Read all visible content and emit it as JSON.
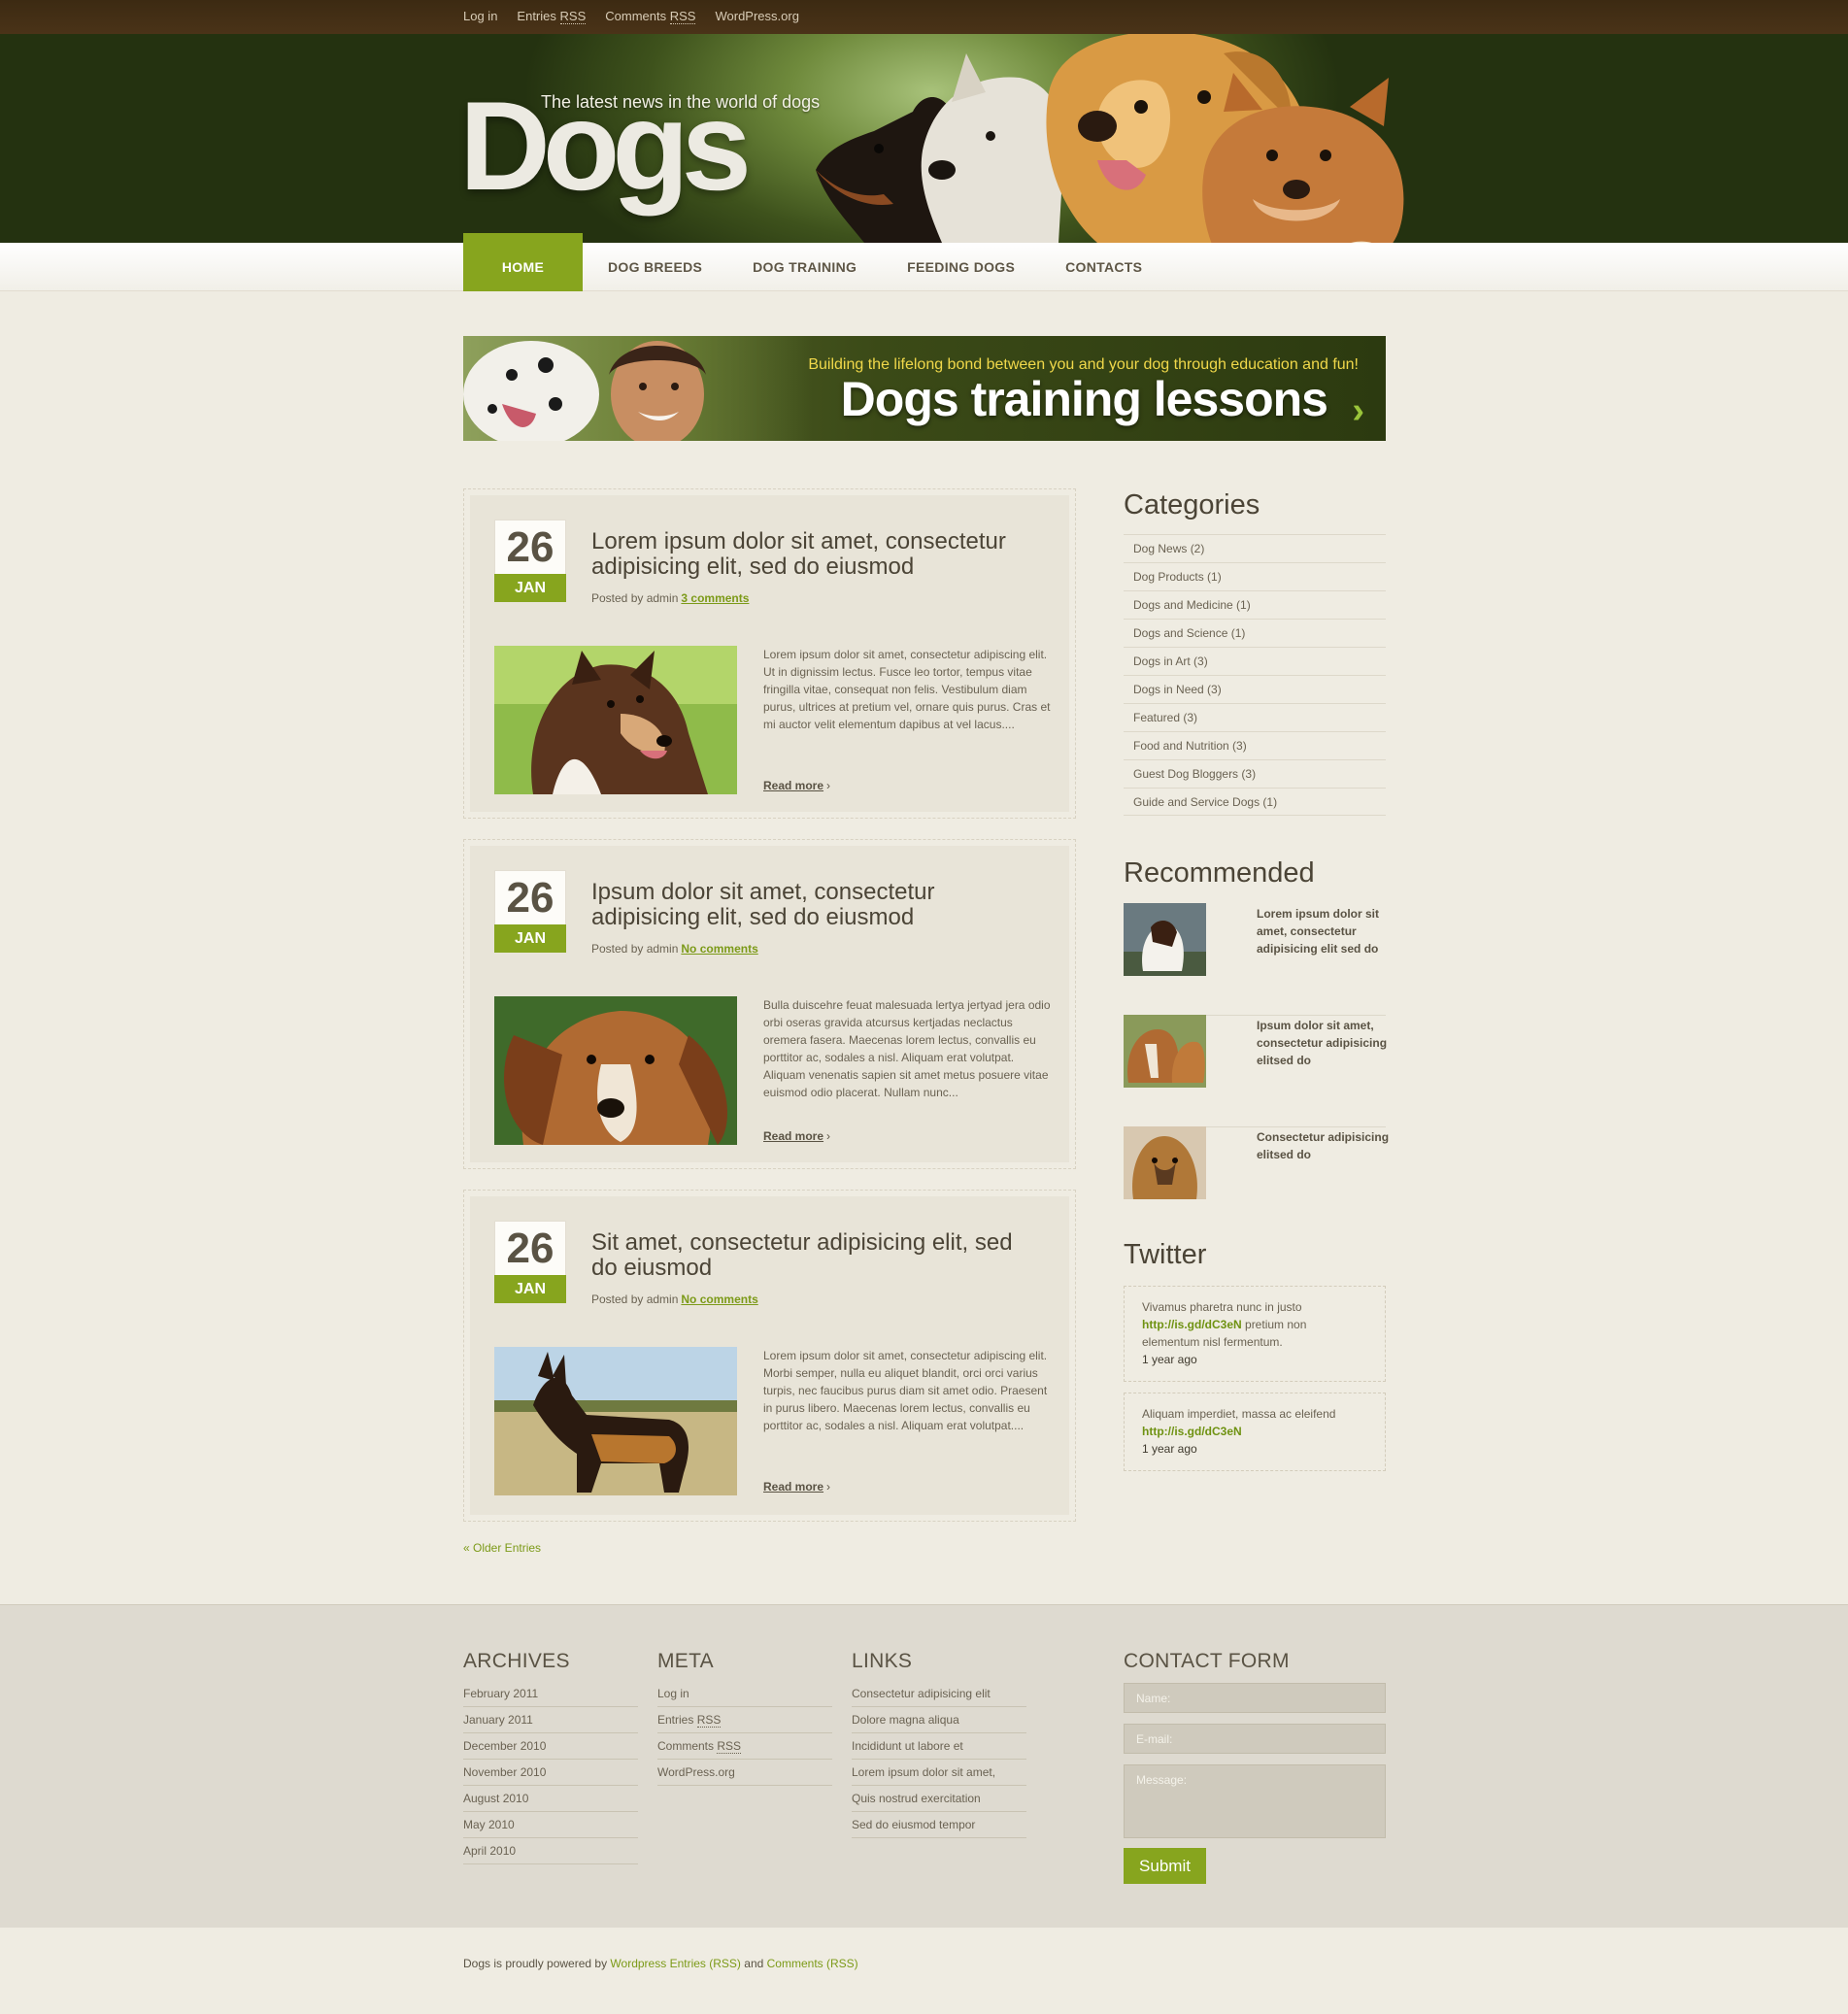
{
  "topbar": {
    "login": "Log in",
    "entries": "Entries",
    "comments": "Comments",
    "rss": "RSS",
    "wordpress": "WordPress.org"
  },
  "header": {
    "logo": "Dogs",
    "tagline": "The latest news in the world of dogs"
  },
  "nav": [
    "HOME",
    "DOG BREEDS",
    "DOG TRAINING",
    "FEEDING DOGS",
    "CONTACTS"
  ],
  "banner": {
    "subtitle": "Building the lifelong bond between you and your dog through education and fun!",
    "title": "Dogs training lessons"
  },
  "posts": [
    {
      "day": "26",
      "month": "JAN",
      "title": "Lorem ipsum dolor sit amet, consectetur adipisicing elit, sed do eiusmod",
      "posted_by": "Posted by admin",
      "comments": "3 comments",
      "excerpt": "Lorem ipsum dolor sit amet, consectetur adipiscing elit. Ut in dignissim lectus. Fusce leo tortor, tempus vitae fringilla vitae, consequat non felis. Vestibulum diam purus, ultrices at pretium vel, ornare quis purus. Cras et mi auctor velit elementum dapibus at vel lacus....",
      "read_more": "Read more"
    },
    {
      "day": "26",
      "month": "JAN",
      "title": "Ipsum dolor sit amet, consectetur adipisicing elit, sed do eiusmod",
      "posted_by": "Posted by admin",
      "comments": "No comments",
      "excerpt": "Bulla duiscehre feuat malesuada lertya jertyad jera odio orbi oseras gravida atcursus kertjadas neclactus oremera fasera. Maecenas lorem lectus, convallis eu porttitor ac, sodales a nisl. Aliquam erat volutpat. Aliquam venenatis sapien sit amet metus posuere vitae euismod odio placerat. Nullam nunc...",
      "read_more": "Read more"
    },
    {
      "day": "26",
      "month": "JAN",
      "title": "Sit amet, consectetur adipisicing elit, sed do eiusmod",
      "posted_by": "Posted by admin",
      "comments": "No comments",
      "excerpt": "Lorem ipsum dolor sit amet, consectetur adipiscing elit. Morbi semper, nulla eu aliquet blandit, orci orci varius turpis, nec faucibus purus diam sit amet odio. Praesent in purus libero. Maecenas lorem lectus, convallis eu porttitor ac, sodales a nisl. Aliquam erat volutpat....",
      "read_more": "Read more"
    }
  ],
  "older_entries": "« Older Entries",
  "sidebar": {
    "categories_title": "Categories",
    "categories": [
      "Dog News (2)",
      "Dog Products (1)",
      "Dogs and Medicine (1)",
      "Dogs and Science (1)",
      "Dogs in Art (3)",
      "Dogs in Need (3)",
      "Featured (3)",
      "Food and Nutrition (3)",
      "Guest Dog Bloggers (3)",
      "Guide and Service Dogs (1)"
    ],
    "recommended_title": "Recommended",
    "recommended": [
      "Lorem ipsum dolor sit amet, consectetur adipisicing elit sed do",
      "Ipsum dolor sit amet, consectetur adipisicing elitsed do",
      "Consectetur adipisicing elitsed do"
    ],
    "twitter_title": "Twitter",
    "tweets": [
      {
        "text_before": "Vivamus pharetra nunc in justo",
        "link": "http://is.gd/dC3eN",
        "text_after": "pretium non elementum nisl fermentum.",
        "ago": "1 year ago"
      },
      {
        "text_before": "Aliquam imperdiet, massa ac eleifend",
        "link": "http://is.gd/dC3eN",
        "text_after": "",
        "ago": "1 year ago"
      }
    ]
  },
  "footer": {
    "archives_title": "ARCHIVES",
    "archives": [
      "February 2011",
      "January 2011",
      "December 2010",
      "November 2010",
      "August 2010",
      "May 2010",
      "April 2010"
    ],
    "meta_title": "META",
    "meta": {
      "login": "Log in",
      "entries": "Entries",
      "comments": "Comments",
      "rss": "RSS",
      "wordpress": "WordPress.org"
    },
    "links_title": "LINKS",
    "links": [
      "Consectetur adipisicing elit",
      "Dolore magna aliqua",
      "Incididunt ut labore et",
      "Lorem ipsum dolor sit amet,",
      "Quis nostrud exercitation",
      "Sed do eiusmod tempor"
    ],
    "contact_title": "CONTACT FORM",
    "name_placeholder": "Name:",
    "email_placeholder": "E-mail:",
    "message_placeholder": "Message:",
    "submit": "Submit"
  },
  "bottom": {
    "prefix": "Dogs is proudly powered by",
    "wordpress": "Wordpress",
    "entries": "Entries (RSS)",
    "and": "and",
    "comments": "Comments (RSS)"
  },
  "colors": {
    "accent": "#87a51e",
    "header_dark": "#243210",
    "topbar": "#3c2a12",
    "page_bg": "#efece2"
  }
}
